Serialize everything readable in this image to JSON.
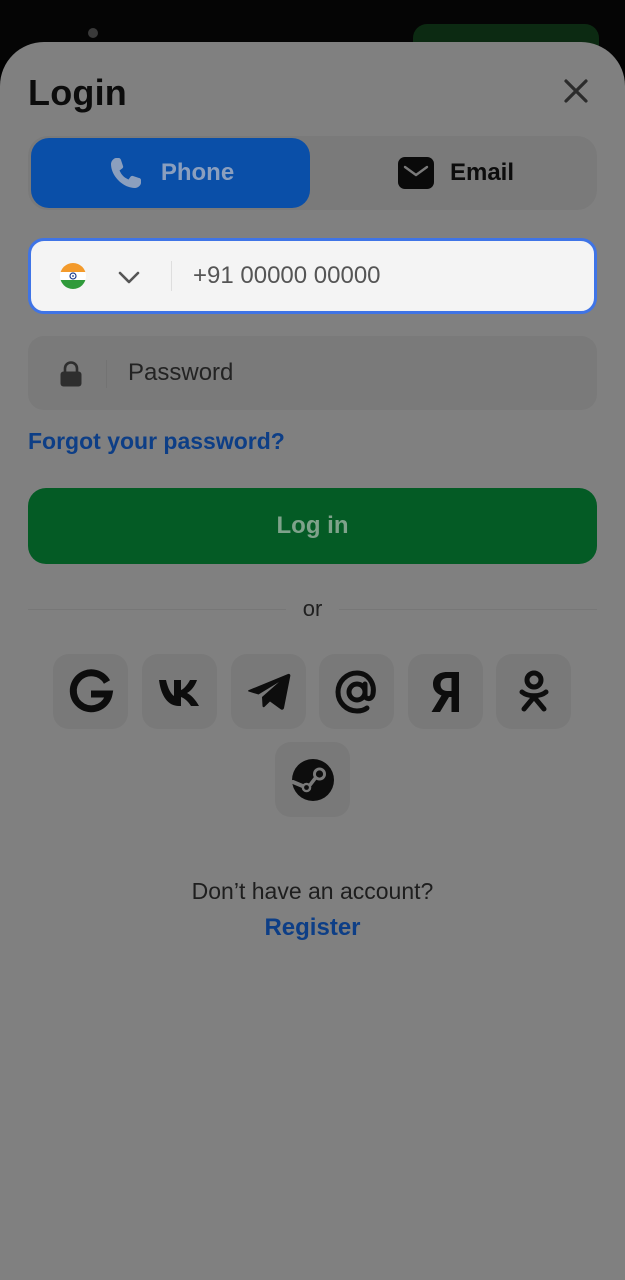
{
  "login_sheet": {
    "title": "Login",
    "close_icon": "close-icon"
  },
  "tabs": [
    {
      "label": "Phone",
      "icon": "phone-icon",
      "selected": true
    },
    {
      "label": "Email",
      "icon": "mail-icon",
      "selected": false
    }
  ],
  "phone_field": {
    "country_flag": "india-flag-icon",
    "dropdown_icon": "chevron-down-icon",
    "prefix": "+91",
    "placeholder": "+91 00000 00000",
    "value": ""
  },
  "password_field": {
    "icon": "lock-icon",
    "placeholder": "Password",
    "value": ""
  },
  "forgot_password": "Forgot your password?",
  "login_button": "Log in",
  "divider_text": "or",
  "social_providers": [
    {
      "name": "google-icon"
    },
    {
      "name": "vk-icon"
    },
    {
      "name": "telegram-icon"
    },
    {
      "name": "mail-ru-icon"
    },
    {
      "name": "yandex-icon"
    },
    {
      "name": "odnoklassniki-icon"
    },
    {
      "name": "steam-icon"
    }
  ],
  "footer": {
    "question": "Don’t have an account?",
    "register_link": "Register"
  },
  "colors": {
    "sheet_background": "#808080",
    "primary_blue": "#0a4fa8",
    "focus_border": "#3f74e6",
    "login_green": "#045b25",
    "link_blue": "#0d3e86"
  }
}
